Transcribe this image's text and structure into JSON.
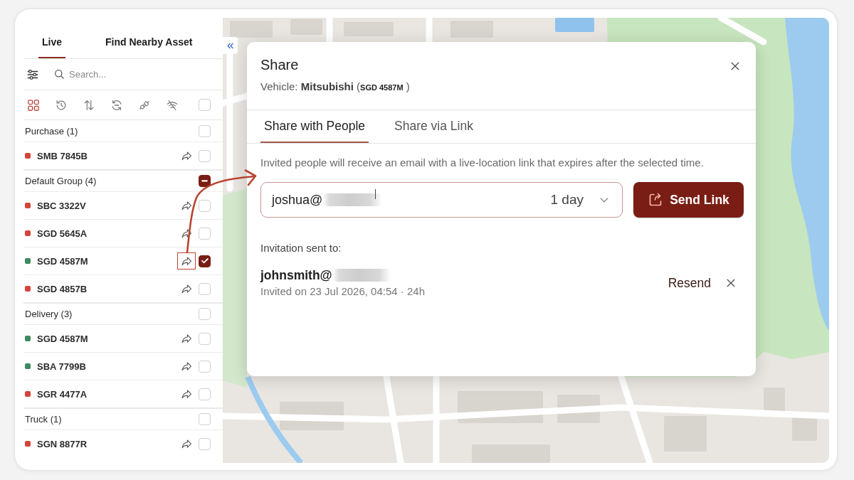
{
  "sidebar": {
    "tabs": [
      {
        "label": "Live",
        "selected": true
      },
      {
        "label": "Find Nearby Asset",
        "selected": false
      }
    ],
    "search": {
      "placeholder": "Search..."
    },
    "filters": [
      {
        "selected": true
      },
      {
        "selected": false
      },
      {
        "selected": false
      },
      {
        "selected": false
      },
      {
        "selected": false
      },
      {
        "selected": false
      }
    ],
    "select_all": {
      "checked": false
    },
    "groups": [
      {
        "name": "Purchase (1)",
        "checked": false,
        "indeterminate": false,
        "vehicles": [
          {
            "plate": "SMB 7845B",
            "color": "#d4453a",
            "checked": false,
            "highlighted": false
          }
        ]
      },
      {
        "name": "Default Group (4)",
        "checked": false,
        "indeterminate": true,
        "vehicles": [
          {
            "plate": "SBC 3322V",
            "color": "#d4453a",
            "checked": false,
            "highlighted": false
          },
          {
            "plate": "SGD 5645A",
            "color": "#d4453a",
            "checked": false,
            "highlighted": false
          },
          {
            "plate": "SGD 4587M",
            "color": "#3d8a5f",
            "checked": true,
            "highlighted": true
          },
          {
            "plate": "SGD 4857B",
            "color": "#d4453a",
            "checked": false,
            "highlighted": false
          }
        ]
      },
      {
        "name": "Delivery (3)",
        "checked": false,
        "indeterminate": false,
        "vehicles": [
          {
            "plate": "SGD 4587M",
            "color": "#3d8a5f",
            "checked": false,
            "highlighted": false
          },
          {
            "plate": "SBA 7799B",
            "color": "#3d8a5f",
            "checked": false,
            "highlighted": false
          },
          {
            "plate": "SGR 4477A",
            "color": "#d4453a",
            "checked": false,
            "highlighted": false
          }
        ]
      },
      {
        "name": "Truck (1)",
        "checked": false,
        "indeterminate": false,
        "vehicles": [
          {
            "plate": "SGN 8877R",
            "color": "#d4453a",
            "checked": false,
            "highlighted": false
          }
        ]
      }
    ]
  },
  "dialog": {
    "title": "Share",
    "subtitle": "Vehicle: **Mitsubishi** (**SGD 4587M** )",
    "tabs": [
      {
        "label": "Share with People",
        "selected": true
      },
      {
        "label": "Share via Link",
        "selected": false
      }
    ],
    "description": "Invited people will receive an email with a live-location link that expires after the selected time.",
    "email": {
      "value": "joshua@",
      "redacted": true,
      "focused": true
    },
    "duration": "1 day",
    "send_button": "Send Link",
    "sent_heading": "Invitation sent to:",
    "invitations": [
      {
        "email": "johnsmith@",
        "redacted": true,
        "meta": "Invited on 23 Jul 2026, 04:54 · 24h",
        "resend": "Resend"
      }
    ]
  }
}
